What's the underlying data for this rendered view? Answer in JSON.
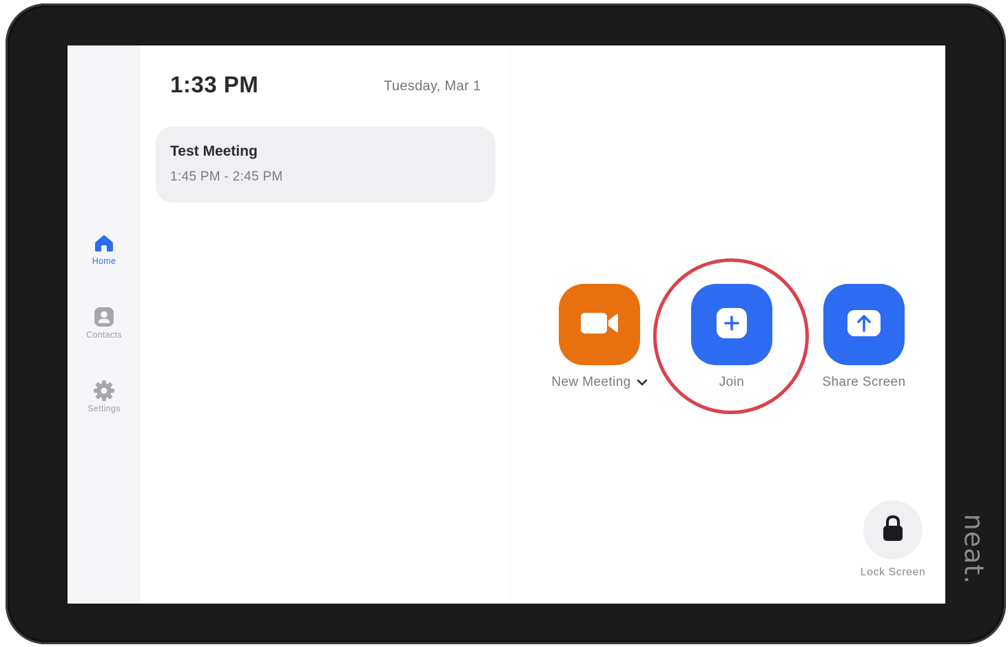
{
  "device": {
    "brand": "neat."
  },
  "sidebar": {
    "items": [
      {
        "label": "Home",
        "icon": "home-icon",
        "active": true
      },
      {
        "label": "Contacts",
        "icon": "contacts-icon",
        "active": false
      },
      {
        "label": "Settings",
        "icon": "gear-icon",
        "active": false
      }
    ]
  },
  "panel": {
    "time": "1:33 PM",
    "date": "Tuesday, Mar 1",
    "meetings": [
      {
        "title": "Test Meeting",
        "time": "1:45 PM - 2:45 PM"
      }
    ]
  },
  "actions": {
    "new_meeting": {
      "label": "New Meeting",
      "icon": "video-camera-icon",
      "color": "#e8700e"
    },
    "join": {
      "label": "Join",
      "icon": "plus-icon",
      "color": "#2d6cf0"
    },
    "share_screen": {
      "label": "Share Screen",
      "icon": "arrow-up-icon",
      "color": "#2d6cf0"
    }
  },
  "lock": {
    "label": "Lock Screen",
    "icon": "lock-icon"
  },
  "colors": {
    "accent": "#2d6cf0",
    "orange": "#e8700e",
    "highlight": "#d9434b",
    "bezel": "#1b1b1c"
  }
}
